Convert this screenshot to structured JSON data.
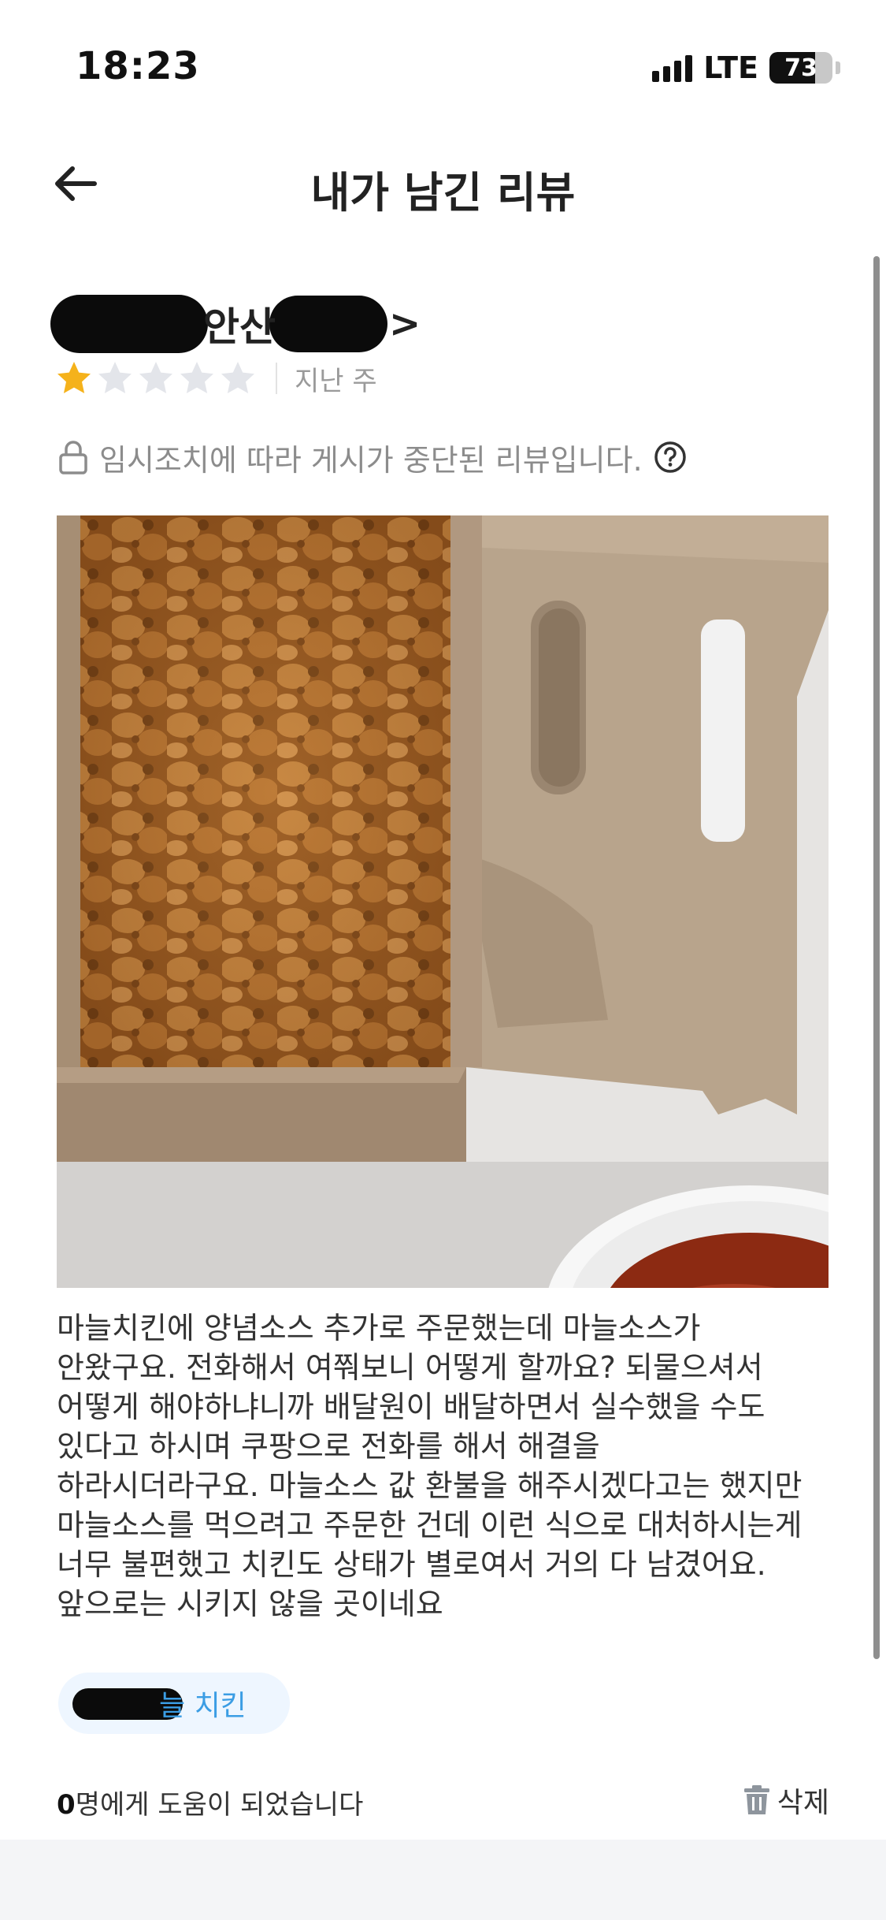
{
  "status_bar": {
    "time": "18:23",
    "network": "LTE",
    "battery": "73",
    "battery_level": 0.73
  },
  "header": {
    "title": "내가 남긴 리뷰",
    "back_icon": "arrow-left-icon"
  },
  "review": {
    "store_name": "안산",
    "store_chevron": ">",
    "rating": 1,
    "rating_max": 5,
    "date": "지난 주",
    "notice": "임시조치에 따라 게시가 중단된 리뷰입니다.",
    "notice_icons": [
      "lock-icon",
      "question-circle-icon"
    ],
    "body": "마늘치킨에 양념소스 추가로 주문했는데 마늘소스가\n안왔구요. 전화해서 여쭤보니 어떻게 할까요? 되물으셔서\n어떻게 해야하냐니까 배달원이 배달하면서 실수했을 수도\n있다고 하시며 쿠팡으로 전화를 해서 해결을\n하라시더라구요. 마늘소스 값 환불을 해주시겠다고는 했지만\n마늘소스를 먹으려고 주문한 건데 이런 식으로 대처하시는게\n너무 불편했고 치킨도 상태가 별로여서 거의 다 남겼어요.\n앞으로는 시키지 않을 곳이네요",
    "menu_tag": "늘 치킨"
  },
  "footer": {
    "helpful_count": "0",
    "helpful_text": "명에게 도움이 되었습니다",
    "delete_label": "삭제",
    "delete_icon": "trash-icon"
  },
  "colors": {
    "star_filled": "#F5B21B",
    "star_empty": "#E3E5EA",
    "tag_bg": "#EEF6FF",
    "tag_text": "#3B9DE4",
    "muted": "#8C8C8C"
  }
}
